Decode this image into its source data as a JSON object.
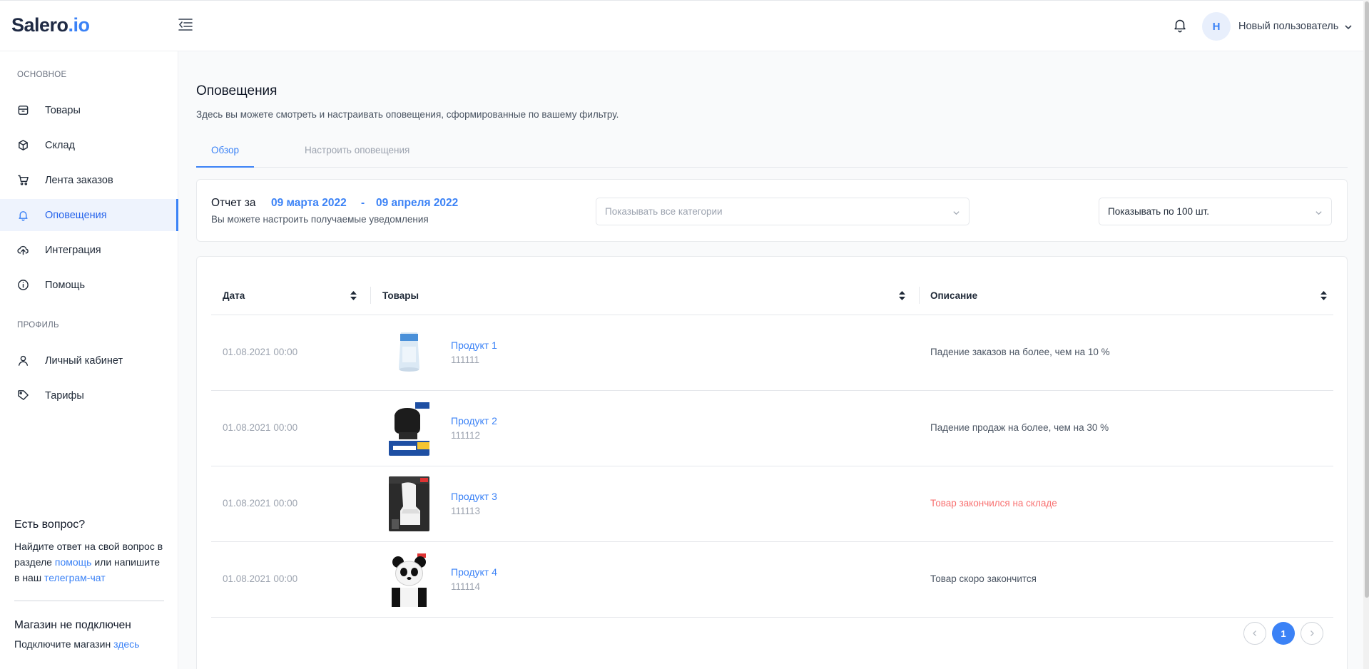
{
  "header": {
    "logo_main": "Salero",
    "logo_accent": ".io",
    "user_initial": "Н",
    "user_name": "Новый пользователь"
  },
  "sidebar": {
    "section_main": "ОСНОВНОЕ",
    "items": [
      {
        "label": "Товары",
        "icon": "box-icon"
      },
      {
        "label": "Склад",
        "icon": "cube-icon"
      },
      {
        "label": "Лента заказов",
        "icon": "cart-icon"
      },
      {
        "label": "Оповещения",
        "icon": "bell-icon",
        "active": true
      },
      {
        "label": "Интеграция",
        "icon": "cloud-upload-icon"
      },
      {
        "label": "Помощь",
        "icon": "info-icon"
      }
    ],
    "section_profile": "ПРОФИЛЬ",
    "profile_items": [
      {
        "label": "Личный кабинет",
        "icon": "user-icon"
      },
      {
        "label": "Тарифы",
        "icon": "tag-icon"
      }
    ],
    "help": {
      "title": "Есть вопрос?",
      "text1": "Найдите ответ на свой вопрос в разделе",
      "link1": "помощь",
      "text2": "или напишите в наш",
      "link2": "телеграм-чат"
    },
    "shop": {
      "title": "Магазин не подключен",
      "text": "Подключите магазин",
      "link": "здесь"
    }
  },
  "main": {
    "title": "Оповещения",
    "subtitle": "Здесь вы можете смотреть и настраивать оповещения, сформированные по вашему фильтру.",
    "tabs": [
      {
        "label": "Обзор",
        "active": true
      },
      {
        "label": "Настроить оповещения",
        "active": false
      }
    ],
    "report": {
      "label": "Отчет за",
      "date_from": "09 марта 2022",
      "separator": "-",
      "date_to": "09 апреля 2022",
      "note": "Вы можете настроить получаемые уведомления"
    },
    "filters": {
      "category_placeholder": "Показывать все категории",
      "page_size": "Показывать по 100 шт."
    },
    "table": {
      "columns": [
        "Дата",
        "Товары",
        "Описание"
      ],
      "rows": [
        {
          "date": "01.08.2021 00:00",
          "product": "Продукт 1",
          "sku": "111111",
          "description": "Падение заказов на более, чем на 10 %",
          "alert": false
        },
        {
          "date": "01.08.2021 00:00",
          "product": "Продукт 2",
          "sku": "111112",
          "description": "Падение продаж на более, чем на 30 %",
          "alert": false
        },
        {
          "date": "01.08.2021 00:00",
          "product": "Продукт 3",
          "sku": "111113",
          "description": "Товар закончился на складе",
          "alert": true
        },
        {
          "date": "01.08.2021 00:00",
          "product": "Продукт 4",
          "sku": "111114",
          "description": "Товар скоро закончится",
          "alert": false
        }
      ]
    },
    "pagination": {
      "current": "1",
      "prev": "‹",
      "next": "›"
    }
  },
  "colors": {
    "accent": "#3b82f6",
    "alert": "#f87171",
    "logo_dark": "#1f2a44"
  }
}
